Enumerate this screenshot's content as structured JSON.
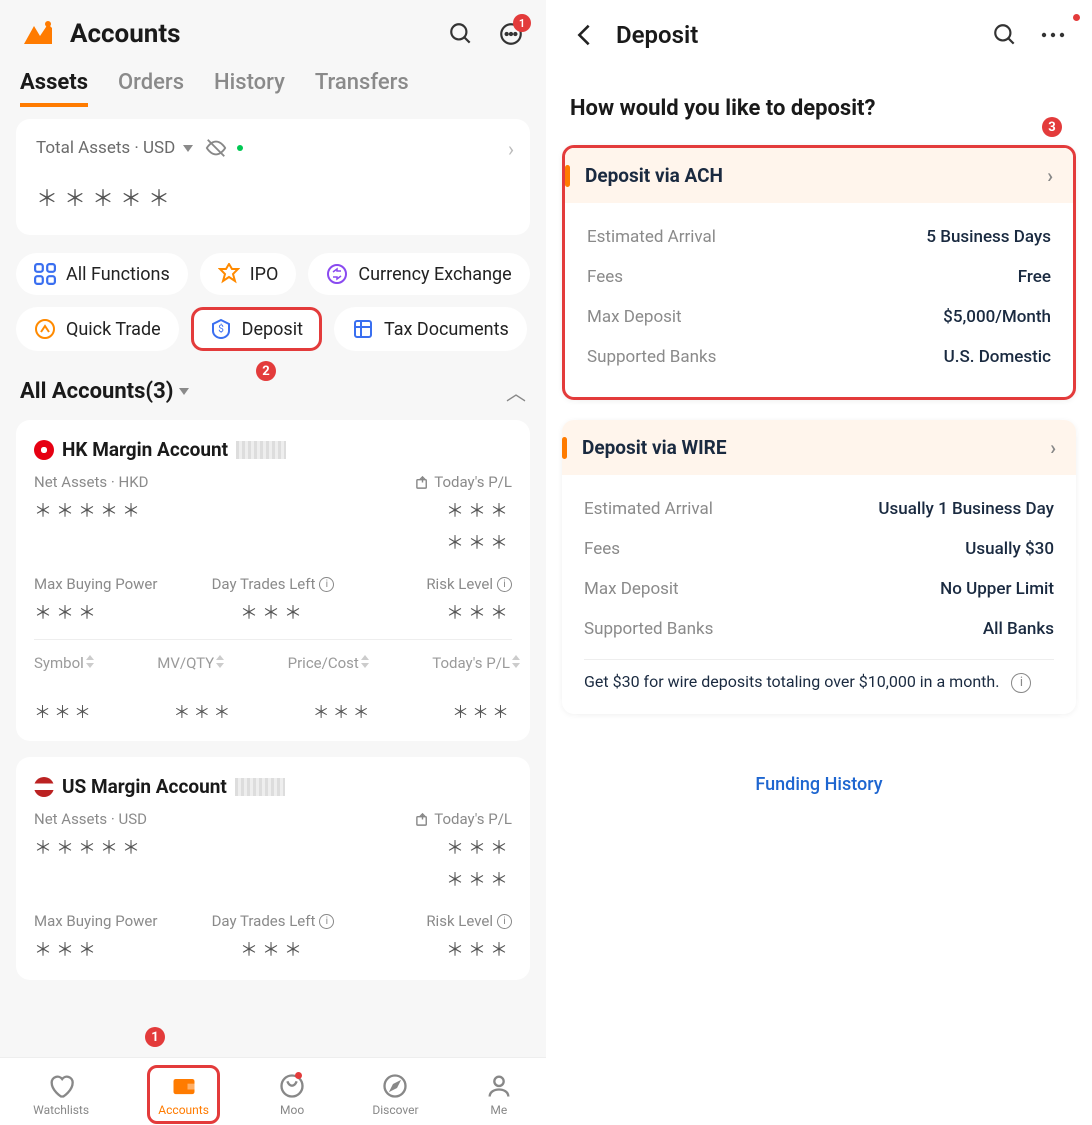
{
  "left": {
    "header_title": "Accounts",
    "msg_badge": "1",
    "tabs": [
      "Assets",
      "Orders",
      "History",
      "Transfers"
    ],
    "active_tab": 0,
    "total_card": {
      "label": "Total Assets · USD",
      "value": "＊＊＊＊＊"
    },
    "func_chips_row1": [
      {
        "icon": "grid",
        "label": "All Functions",
        "color": "#3a6ff0"
      },
      {
        "icon": "ipo",
        "label": "IPO",
        "color": "#ff8a00"
      },
      {
        "icon": "exchange",
        "label": "Currency Exchange",
        "color": "#8a4af0"
      }
    ],
    "func_chips_row2": [
      {
        "icon": "trade",
        "label": "Quick Trade",
        "color": "#ff8a00"
      },
      {
        "icon": "deposit",
        "label": "Deposit",
        "color": "#3a6ff0",
        "highlight": true
      },
      {
        "icon": "docs",
        "label": "Tax Documents",
        "color": "#3a6ff0"
      }
    ],
    "all_accounts_label": "All Accounts(3)",
    "accounts": [
      {
        "flag": "hk",
        "name": "HK Margin Account",
        "net_assets_label": "Net Assets · HKD",
        "pl_label": "Today's P/L",
        "net_assets_value": "＊＊＊＊＊",
        "pl_value1": "＊＊＊",
        "pl_value2": "＊＊＊",
        "metrics": [
          {
            "label": "Max Buying Power",
            "value": "＊＊＊"
          },
          {
            "label": "Day Trades Left",
            "value": "＊＊＊",
            "info": true
          },
          {
            "label": "Risk Level",
            "value": "＊＊＊",
            "info": true
          }
        ],
        "table_headers": [
          "Symbol",
          "MV/QTY",
          "Price/Cost",
          "Today's P/L"
        ],
        "table_row": [
          "＊＊＊",
          "＊＊＊",
          "＊＊＊",
          "＊＊＊"
        ]
      },
      {
        "flag": "us",
        "name": "US Margin Account",
        "net_assets_label": "Net Assets · USD",
        "pl_label": "Today's P/L",
        "net_assets_value": "＊＊＊＊＊",
        "pl_value1": "＊＊＊",
        "pl_value2": "＊＊＊",
        "metrics": [
          {
            "label": "Max Buying Power",
            "value": "＊＊＊"
          },
          {
            "label": "Day Trades Left",
            "value": "＊＊＊",
            "info": true
          },
          {
            "label": "Risk Level",
            "value": "＊＊＊",
            "info": true
          }
        ]
      }
    ],
    "bottom_nav": [
      "Watchlists",
      "Accounts",
      "Moo",
      "Discover",
      "Me"
    ],
    "bottom_nav_active": 1,
    "callouts": {
      "1": "1",
      "2": "2"
    }
  },
  "right": {
    "header_title": "Deposit",
    "question": "How would you like to deposit?",
    "callout_3": "3",
    "methods": [
      {
        "title": "Deposit via ACH",
        "highlight": true,
        "rows": [
          {
            "label": "Estimated Arrival",
            "value": "5 Business Days"
          },
          {
            "label": "Fees",
            "value": "Free"
          },
          {
            "label": "Max Deposit",
            "value": "$5,000/Month"
          },
          {
            "label": "Supported Banks",
            "value": "U.S. Domestic"
          }
        ]
      },
      {
        "title": "Deposit via WIRE",
        "highlight": false,
        "rows": [
          {
            "label": "Estimated Arrival",
            "value": "Usually 1 Business Day"
          },
          {
            "label": "Fees",
            "value": "Usually $30"
          },
          {
            "label": "Max Deposit",
            "value": "No Upper Limit"
          },
          {
            "label": "Supported Banks",
            "value": "All Banks"
          }
        ],
        "note": "Get $30 for wire deposits totaling over $10,000 in a month."
      }
    ],
    "funding_link": "Funding History"
  }
}
